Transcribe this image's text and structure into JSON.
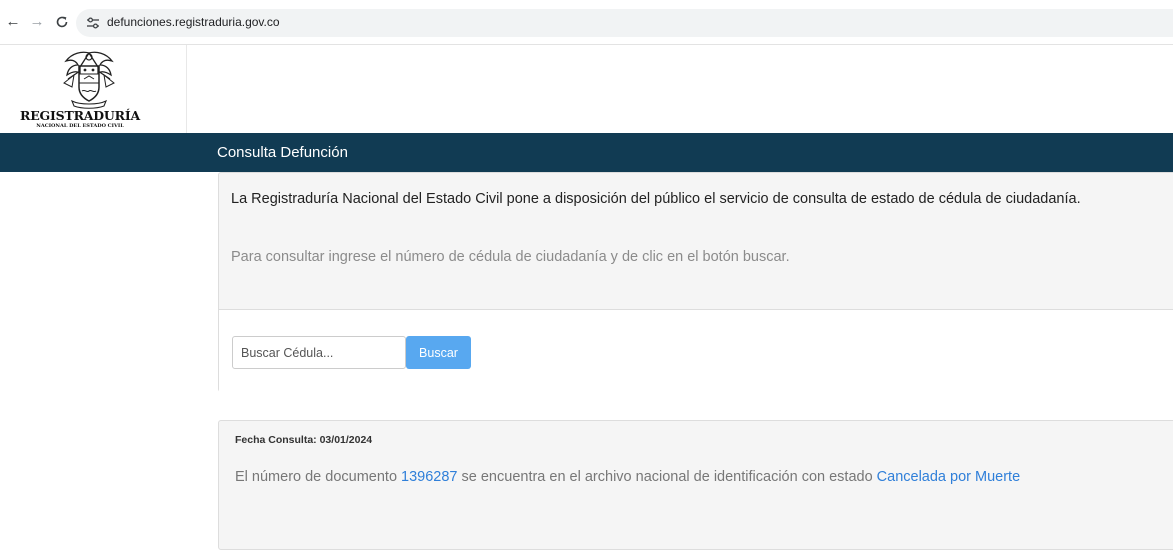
{
  "browser": {
    "url": "defunciones.registraduria.gov.co",
    "back_icon": "arrow-left-icon",
    "forward_icon": "arrow-right-icon",
    "reload_icon": "reload-icon",
    "site_info_icon": "tune-icon"
  },
  "logo": {
    "line1": "REGISTRADURÍA",
    "line2": "NACIONAL DEL ESTADO CIVIL",
    "icon": "coat-of-arms-icon"
  },
  "header": {
    "title": "Consulta Defunción"
  },
  "intro": {
    "lead": "La Registraduría Nacional del Estado Civil pone a disposición del público el servicio de consulta de estado de cédula de ciudadanía.",
    "instruction": "Para consultar ingrese el número de cédula de ciudadanía y de clic en el botón buscar."
  },
  "search": {
    "placeholder": "Buscar Cédula...",
    "button_label": "Buscar"
  },
  "result": {
    "date_label": "Fecha Consulta: 03/01/2024",
    "prefix": "El número de documento ",
    "document_number": "1396287",
    "middle": " se encuentra en el archivo nacional de identificación con estado ",
    "status": "Cancelada por Muerte"
  },
  "colors": {
    "header_bg": "#113b53",
    "accent_blue": "#2f7fd9",
    "button_blue": "#58a8f0",
    "panel_bg": "#f5f5f5"
  }
}
